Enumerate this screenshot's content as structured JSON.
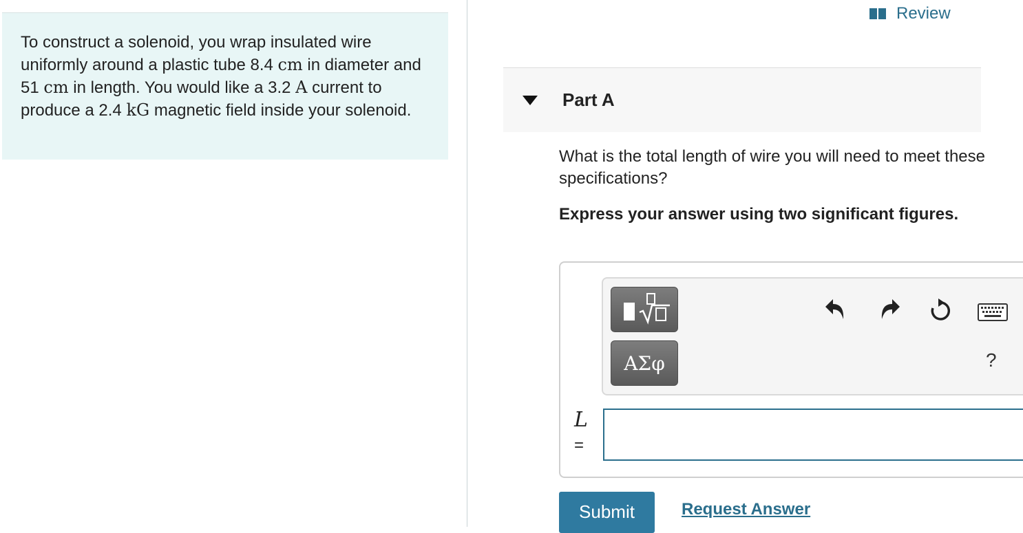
{
  "problem": {
    "segments": [
      {
        "t": "To construct a solenoid, you wrap insulated wire uniformly around a plastic tube 8.4 "
      },
      {
        "t": "cm",
        "math": true
      },
      {
        "t": " in diameter and 51 "
      },
      {
        "t": "cm",
        "math": true
      },
      {
        "t": " in length. You would like a 3.2 "
      },
      {
        "t": "A",
        "math": true
      },
      {
        "t": " current to produce a 2.4 "
      },
      {
        "t": "kG",
        "math": true
      },
      {
        "t": " magnetic field inside your solenoid."
      }
    ]
  },
  "review": {
    "label": "Review",
    "icon": "book-icon"
  },
  "part": {
    "title": "Part A",
    "caret_icon": "caret-down-icon"
  },
  "question": {
    "prompt": "What is the total length of wire you will need to meet these specifications?",
    "instruction": "Express your answer using two significant figures."
  },
  "toolbar": {
    "templates_icon": "templates-sqrt-icon",
    "symbols_label": "ΑΣφ",
    "undo_icon": "undo-icon",
    "redo_icon": "redo-icon",
    "reset_icon": "reset-icon",
    "keyboard_icon": "keyboard-icon",
    "help_label": "?"
  },
  "answer": {
    "variable": "L",
    "equals": "=",
    "value": ""
  },
  "actions": {
    "submit_label": "Submit",
    "request_answer_label": "Request Answer"
  },
  "colors": {
    "accent": "#2a6e8c",
    "panel_bg": "#e8f6f6",
    "submit_bg": "#2f7aa0"
  }
}
